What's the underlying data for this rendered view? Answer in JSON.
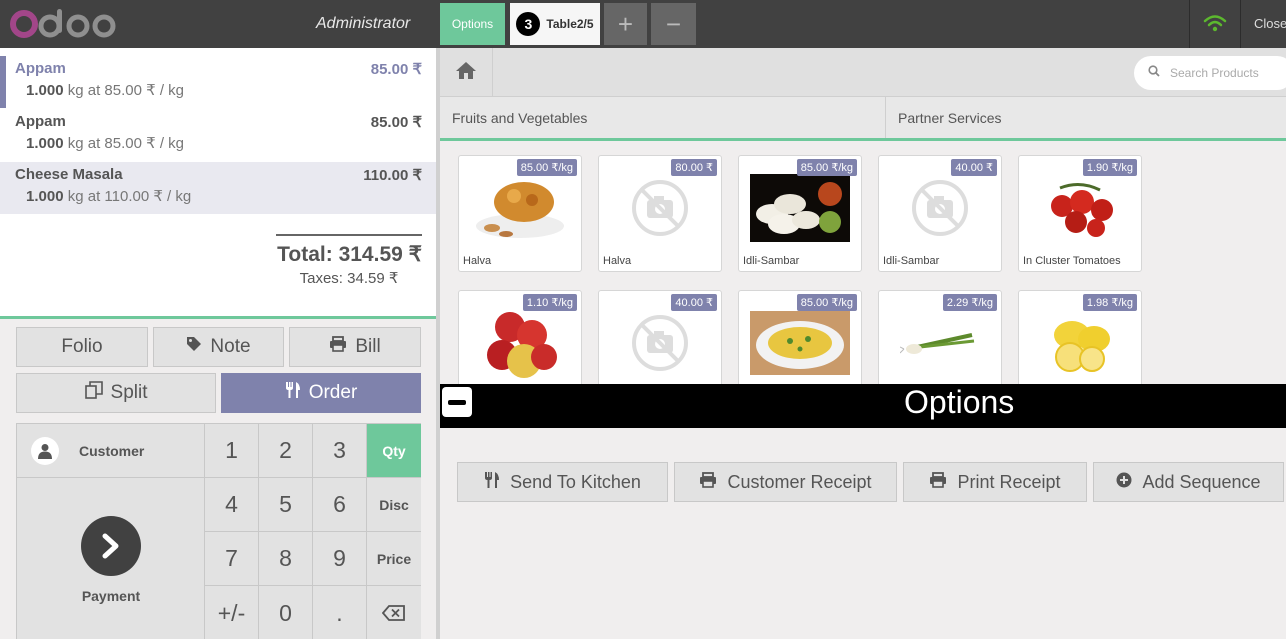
{
  "header": {
    "username": "Administrator",
    "options_label": "Options",
    "table_count": "3",
    "table_label": "Table2/5",
    "add_label": "+",
    "remove_label": "−",
    "close_label": "Close",
    "wifi_icon": "wifi-icon"
  },
  "order": {
    "lines": [
      {
        "name": "Appam",
        "price": "85.00 ₹",
        "qty": "1.000",
        "detail": " kg at 85.00 ₹ / kg"
      },
      {
        "name": "Appam",
        "price": "85.00 ₹",
        "qty": "1.000",
        "detail": " kg at 85.00 ₹ / kg"
      },
      {
        "name": "Cheese Masala",
        "price": "110.00 ₹",
        "qty": "1.000",
        "detail": " kg at 110.00 ₹ / kg"
      }
    ],
    "total": "Total: 314.59 ₹",
    "taxes": "Taxes: 34.59 ₹"
  },
  "controls": {
    "folio": "Folio",
    "note": "Note",
    "bill": "Bill",
    "split": "Split",
    "order": "Order",
    "customer": "Customer",
    "payment": "Payment",
    "numpad": [
      "1",
      "2",
      "3",
      "4",
      "5",
      "6",
      "7",
      "8",
      "9",
      "+/-",
      "0",
      "."
    ],
    "modes": [
      "Qty",
      "Disc",
      "Price"
    ],
    "active_mode": "Qty"
  },
  "search": {
    "placeholder": "Search Products"
  },
  "categories": [
    "Fruits and Vegetables",
    "Partner Services"
  ],
  "products": [
    {
      "name": "Halva",
      "price": "85.00 ₹/kg",
      "image": "halva-image"
    },
    {
      "name": "Halva",
      "price": "80.00 ₹",
      "image": "no-image-icon"
    },
    {
      "name": "Idli-Sambar",
      "price": "85.00 ₹/kg",
      "image": "idli-image"
    },
    {
      "name": "Idli-Sambar",
      "price": "40.00 ₹",
      "image": "no-image-icon"
    },
    {
      "name": "In Cluster Tomatoes",
      "price": "1.90 ₹/kg",
      "image": "tomatoes-image"
    },
    {
      "name": "",
      "price": "1.10 ₹/kg",
      "image": "apples-image"
    },
    {
      "name": "",
      "price": "40.00 ₹",
      "image": "no-image-icon"
    },
    {
      "name": "",
      "price": "85.00 ₹/kg",
      "image": "poha-image"
    },
    {
      "name": "",
      "price": "2.29 ₹/kg",
      "image": "onion-image"
    },
    {
      "name": "",
      "price": "1.98 ₹/kg",
      "image": "lemons-image"
    }
  ],
  "options_panel": {
    "title": "Options",
    "buttons": [
      "Send To Kitchen",
      "Customer Receipt",
      "Print Receipt",
      "Add Sequence"
    ]
  },
  "colors": {
    "accent": "#6ec89b",
    "brand": "#7f82ac",
    "header": "#414141"
  }
}
